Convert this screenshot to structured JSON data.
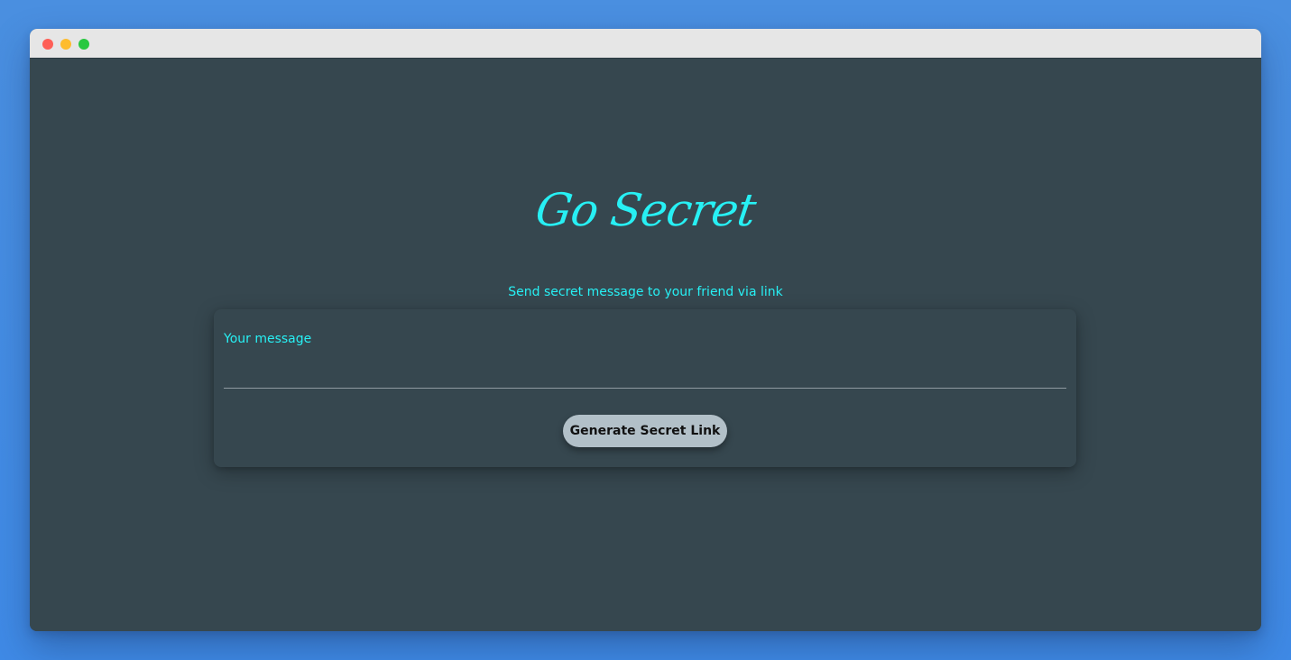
{
  "window": {
    "controls": [
      "close-control",
      "minimize-control",
      "maximize-control"
    ]
  },
  "app": {
    "title": "Go Secret",
    "subtitle": "Send secret message to your friend via link"
  },
  "form": {
    "message_label": "Your message",
    "message_value": "",
    "generate_label": "Generate Secret Link"
  },
  "colors": {
    "background": "#36474f",
    "accent": "#27f0f4",
    "button": "#b2c0c8",
    "desktop": "#4a8fe0"
  }
}
